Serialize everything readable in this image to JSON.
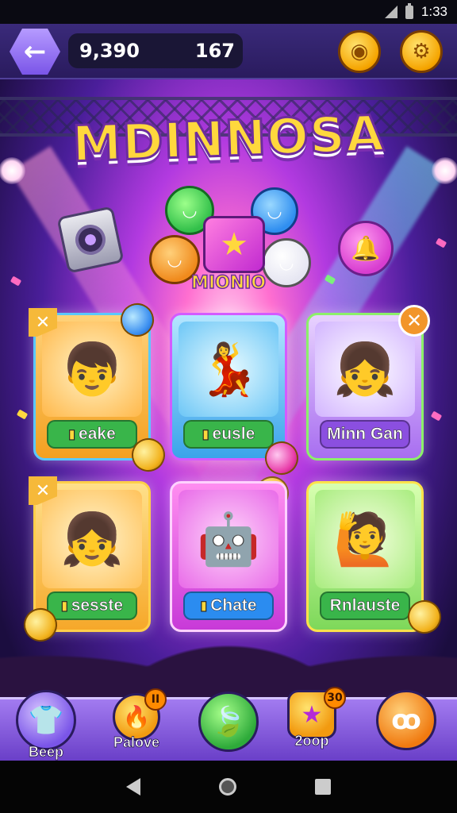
{
  "status_bar": {
    "time": "1:33"
  },
  "top_bar": {
    "back_icon": "arrow-left-icon",
    "currency_primary": "9,390",
    "currency_secondary": "167",
    "coin_icon": "gold-coin-icon",
    "settings_icon": "gear-icon"
  },
  "title": {
    "line": "MDINNOSA"
  },
  "mascot_logo": "MIONIO",
  "cards": [
    {
      "label": "eake",
      "label_icon": "card-tag-icon",
      "art": "boy-character",
      "corner": "star-tab",
      "accent": "#f39a1e"
    },
    {
      "label": "eusle",
      "label_icon": "card-tag-icon",
      "art": "dancing-girl",
      "corner": "none",
      "accent": "#3ea9f0"
    },
    {
      "label": "Minn Gan",
      "label_icon": "",
      "art": "group-characters",
      "corner": "close-badge",
      "accent": "#a86ef0"
    },
    {
      "label": "sesste",
      "label_icon": "card-tag-icon",
      "art": "singer-girl",
      "corner": "star-tab",
      "accent": "#f7b431"
    },
    {
      "label": "Chate",
      "label_icon": "card-tag-icon",
      "art": "yellow-robot",
      "corner": "none",
      "accent": "#d846e0"
    },
    {
      "label": "Rnlauste",
      "label_icon": "",
      "art": "waving-girl",
      "corner": "none",
      "accent": "#6fd04a"
    }
  ],
  "bottom_nav": [
    {
      "label": "Beep",
      "icon": "shirt-icon"
    },
    {
      "label": "Palove",
      "icon": "fire-icon",
      "badge": ""
    },
    {
      "label": "",
      "icon": "leaf-icon"
    },
    {
      "label": "2oop",
      "icon": "star-icon",
      "badge": "30"
    },
    {
      "label": "",
      "icon": "swirl-icon"
    }
  ],
  "colors": {
    "top_bar": "#2a1b5e",
    "bottom_bar": "#8a5ee0",
    "title_yellow": "#ffd83d",
    "label_green": "#39b54a",
    "label_blue": "#2b8cf0",
    "label_purple": "#8b4fe0"
  }
}
